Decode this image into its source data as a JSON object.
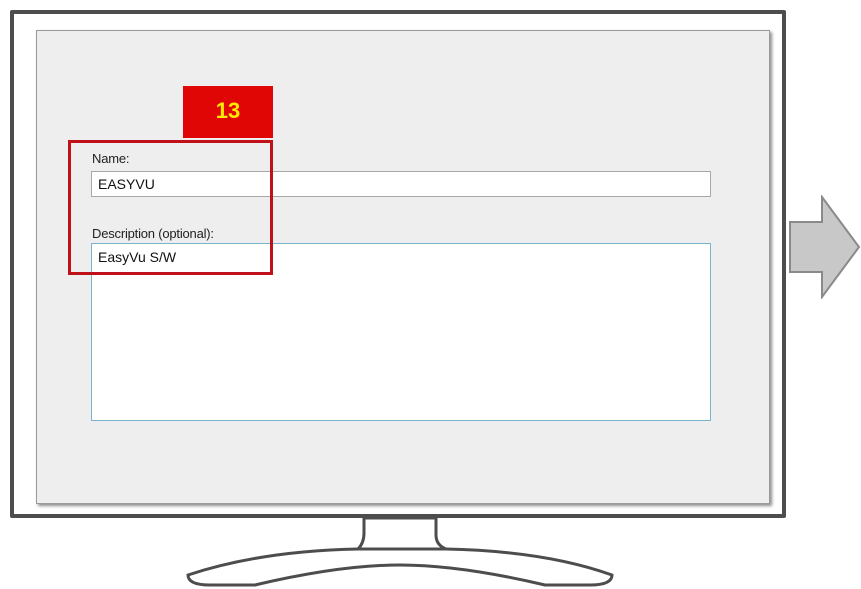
{
  "form": {
    "name_label": "Name:",
    "name_value": "EASYVU",
    "description_label": "Description (optional):",
    "description_value": "EasyVu S/W"
  },
  "annotation": {
    "step_number": "13"
  },
  "colors": {
    "badge_bg": "#e10606",
    "badge_text": "#ffea00",
    "highlight_border": "#c0111a",
    "arrow_fill": "#c8c8c8"
  },
  "icons": [
    "next-arrow-icon"
  ]
}
